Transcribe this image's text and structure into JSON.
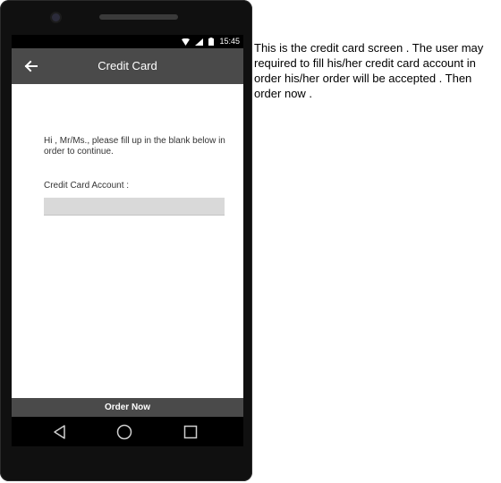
{
  "status_bar": {
    "time": "15:45"
  },
  "app_bar": {
    "title": "Credit Card"
  },
  "form": {
    "instruction": "Hi , Mr/Ms., please fill up in the blank below in order to continue.",
    "card_label": "Credit Card Account :",
    "card_value": ""
  },
  "order_button_label": "Order Now",
  "annotation": "This is the credit card screen . The user may required to fill his/her credit card account in order his/her order will be accepted . Then order now ."
}
